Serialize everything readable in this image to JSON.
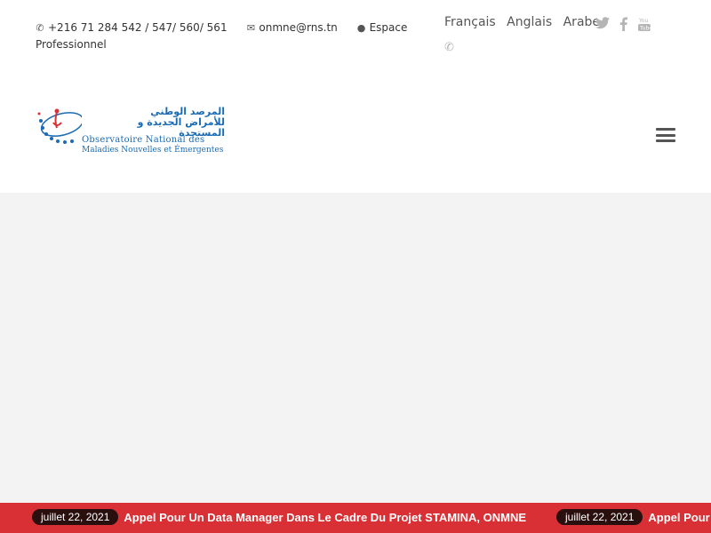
{
  "topbar": {
    "phone": "+216 71 284 542 / 547/ 560/ 561",
    "email": "onmne@rns.tn",
    "espace_pro": "Espace Professionnel",
    "icons": {
      "phone": "phone-icon",
      "email": "envelope-icon",
      "user": "user-icon"
    }
  },
  "languages": [
    "Français",
    "Anglais",
    "Arabe"
  ],
  "social": [
    "twitter-icon",
    "facebook-icon",
    "youtube-icon"
  ],
  "logo": {
    "arabic": "المرصد الوطني للأمراض الجديدة و المستجدة",
    "line1": "Observatoire National des",
    "line2": "Maladies Nouvelles et Émergentes"
  },
  "ticker": [
    {
      "date": "juillet 22, 2021",
      "title": "Appel Pour Un Data Manager Dans Le Cadre Du Projet STAMINA, ONMNE"
    },
    {
      "date": "juillet 22, 2021",
      "title": "Appel Pour Un Data Manager Dans Le Cadre Du Projet STAMINA, ONMNE"
    }
  ],
  "colors": {
    "ticker_bg": "#d83035",
    "brand_blue": "#1a6bb5"
  }
}
